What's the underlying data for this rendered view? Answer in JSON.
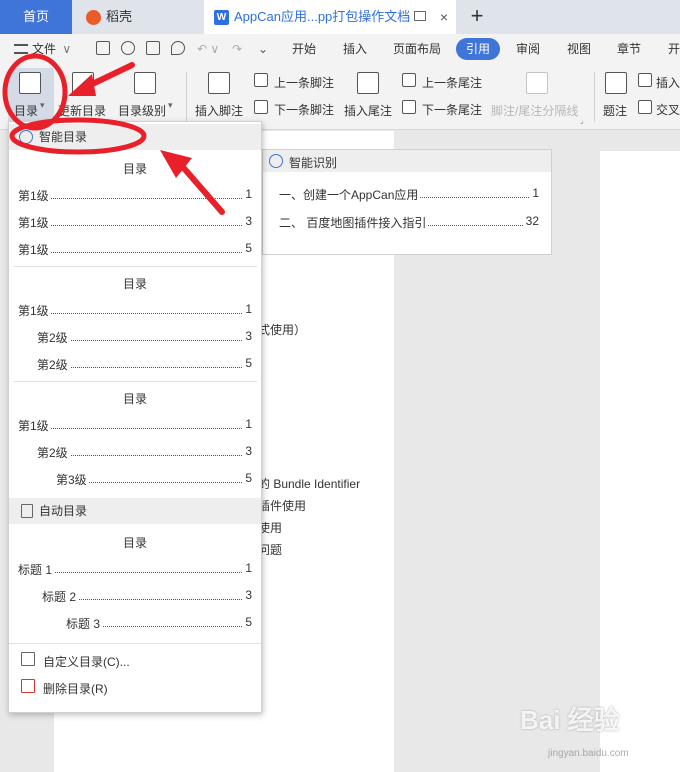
{
  "tabs": {
    "home": "首页",
    "daoke": "稻壳",
    "document": "AppCan应用...pp打包操作文档",
    "close": "×",
    "add": "+"
  },
  "menubar": {
    "file": "文件",
    "items": [
      "开始",
      "插入",
      "页面布局",
      "引用",
      "审阅",
      "视图",
      "章节",
      "开"
    ]
  },
  "ribbon": {
    "toc": "目录",
    "update_toc": "更新目录",
    "toc_level": "目录级别",
    "insert_footnote": "插入脚注",
    "prev_footnote": "上一条脚注",
    "next_footnote": "下一条脚注",
    "insert_endnote": "插入尾注",
    "prev_endnote": "上一条尾注",
    "next_endnote": "下一条尾注",
    "footnote_separator": "脚注/尾注分隔线",
    "caption": "题注",
    "insert": "插入",
    "cross_ref": "交叉"
  },
  "dropdown": {
    "smart_header": "智能目录",
    "blocks": [
      {
        "title": "目录",
        "lines": [
          {
            "text": "第1级",
            "page": "1"
          },
          {
            "text": "第1级",
            "page": "3"
          },
          {
            "text": "第1级",
            "page": "5"
          }
        ]
      },
      {
        "title": "目录",
        "lines": [
          {
            "text": "第1级",
            "page": "1"
          },
          {
            "text": "第2级",
            "page": "3"
          },
          {
            "text": "第2级",
            "page": "5"
          }
        ]
      },
      {
        "title": "目录",
        "lines": [
          {
            "text": "第1级",
            "page": "1"
          },
          {
            "text": "第2级",
            "page": "3"
          },
          {
            "text": "第3级",
            "page": "5"
          }
        ]
      }
    ],
    "auto_header": "自动目录",
    "auto_block": {
      "title": "目录",
      "lines": [
        {
          "text": "标题 1",
          "page": "1"
        },
        {
          "text": "标题 2",
          "page": "3"
        },
        {
          "text": "标题 3",
          "page": "5"
        }
      ]
    },
    "custom_toc": "自定义目录(C)...",
    "delete_toc": "删除目录(R)"
  },
  "smart_panel": {
    "header": "智能识别",
    "entries": [
      {
        "text": "一、创建一个AppCan应用",
        "page": "1"
      },
      {
        "text": "二、 百度地图插件接入指引",
        "page": "32"
      }
    ]
  },
  "document": {
    "lines": [
      "式使用）",
      "的 Bundle Identifier",
      "插件使用",
      "使用",
      "问题"
    ]
  },
  "watermark": {
    "main": "Bai 经验",
    "sub": "jingyan.baidu.com"
  },
  "colors": {
    "accent": "#3f74d8",
    "annotation": "#e8202a"
  }
}
